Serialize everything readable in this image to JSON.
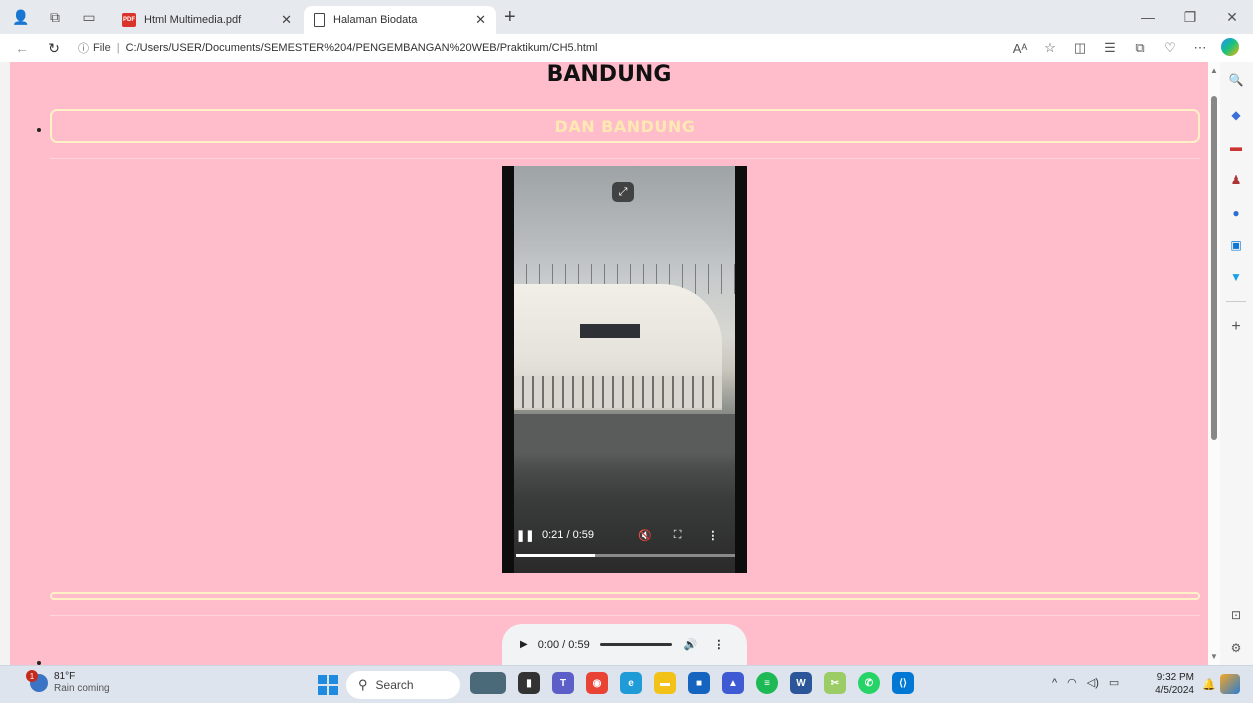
{
  "browser": {
    "tabs": [
      {
        "title": "Html Multimedia.pdf",
        "icon": "pdf-icon",
        "active": false
      },
      {
        "title": "Halaman Biodata",
        "icon": "document-icon",
        "active": true
      }
    ],
    "address": {
      "info_label": "ⓘ",
      "scheme_label": "File",
      "separator": "|",
      "url": "C:/Users/USER/Documents/SEMESTER%204/PENGEMBANGAN%20WEB/Praktikum/CH5.html"
    }
  },
  "page": {
    "heading": "BANDUNG",
    "banner_text": "DAN BANDUNG",
    "video": {
      "time": "0:21 / 0:59",
      "progress": 0.36
    },
    "audio": {
      "time": "0:00 / 0:59"
    }
  },
  "taskbar": {
    "weather_temp": "81°F",
    "weather_desc": "Rain coming",
    "weather_badge": "1",
    "search_placeholder": "Search",
    "clock_time": "9:32 PM",
    "clock_date": "4/5/2024"
  },
  "colors": {
    "page_background": "#ffbccb",
    "banner_border": "#fff0c8",
    "banner_text": "#ffe8b2"
  }
}
